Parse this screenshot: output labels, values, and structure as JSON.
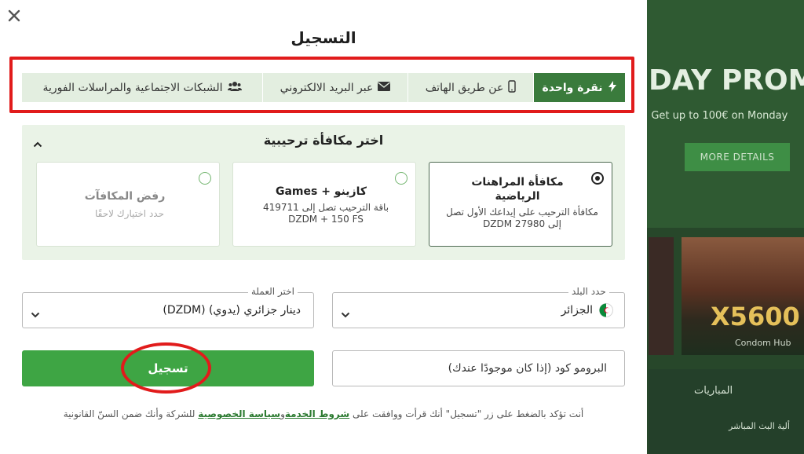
{
  "background": {
    "promo_text": "DAY PROMO",
    "promo_sub": "! Get up to 100€ on Monday",
    "more_details": "MORE DETAILS",
    "multiplier": "X5600",
    "game_name": "Condom Hub",
    "tab_label": "المباريات",
    "live_label": "ألية البث المباشر"
  },
  "modal": {
    "title": "التسجيل",
    "close_icon": "close-icon",
    "tabs": [
      {
        "label": "نقرة واحدة",
        "icon": "lightning-icon",
        "active": true
      },
      {
        "label": "عن طريق الهاتف",
        "icon": "phone-icon",
        "active": false
      },
      {
        "label": "عبر البريد الالكتروني",
        "icon": "envelope-icon",
        "active": false
      },
      {
        "label": "الشبكات الاجتماعية والمراسلات الفورية",
        "icon": "users-icon",
        "active": false
      }
    ],
    "bonus_panel": {
      "title": "اختر مكافأة ترحيبية",
      "options": [
        {
          "name": "مكافأة المراهنات الرياضية",
          "desc": "مكافأة الترحيب على إيداعك الأول تصل إلى DZDM 27980",
          "selected": true
        },
        {
          "name": "كازينو + Games",
          "desc": "باقة الترحيب تصل إلى 419711 DZDM + 150 FS",
          "selected": false
        },
        {
          "name": "رفض المكافآت",
          "desc": "حدد اختيارك لاحقًا",
          "selected": false
        }
      ]
    },
    "country": {
      "label": "حدد البلد",
      "value": "الجزائر"
    },
    "currency": {
      "label": "اختر العملة",
      "value": "دينار جزائري (يدوي) (DZDM)"
    },
    "register_button": "تسجيل",
    "promo_placeholder": "البرومو كود (إذا كان موجودًا عندك)",
    "terms": {
      "prefix": "أنت تؤكد بالضغط على زر \"تسجيل\" أنك قرأت ووافقت على",
      "terms_link": "شروط الخدمة",
      "and": "و",
      "privacy_link": "سياسة الخصوصية",
      "suffix": "للشركة وأنك ضمن السنّ القانونية"
    }
  },
  "colors": {
    "accent": "#3ea544",
    "tab_active": "#3a7b3c",
    "annotation": "#e11b1b"
  }
}
